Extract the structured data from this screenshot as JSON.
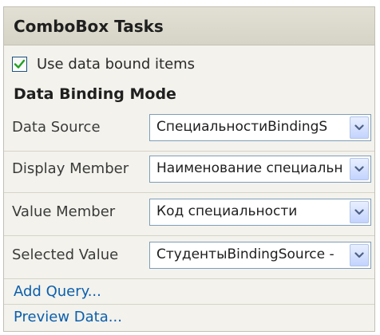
{
  "panel": {
    "title": "ComboBox Tasks"
  },
  "use_data_bound": {
    "label": "Use data bound items",
    "checked": true
  },
  "section": {
    "title": "Data Binding Mode"
  },
  "fields": {
    "data_source": {
      "label": "Data Source",
      "value": "СпециальностиBindingS"
    },
    "display_member": {
      "label": "Display Member",
      "value": "Наименование специальн"
    },
    "value_member": {
      "label": "Value Member",
      "value": "Код специальности"
    },
    "selected_value": {
      "label": "Selected Value",
      "value": "СтудентыBindingSource -"
    }
  },
  "links": {
    "add_query": "Add Query...",
    "preview_data": "Preview Data..."
  },
  "colors": {
    "panel_bg": "#f3f2ec",
    "link": "#0b5fae",
    "checkmark": "#21a121",
    "combo_border": "#7f9db9"
  },
  "icons": {
    "checkbox": "checkmark-icon",
    "dropdown": "chevron-down-icon"
  }
}
